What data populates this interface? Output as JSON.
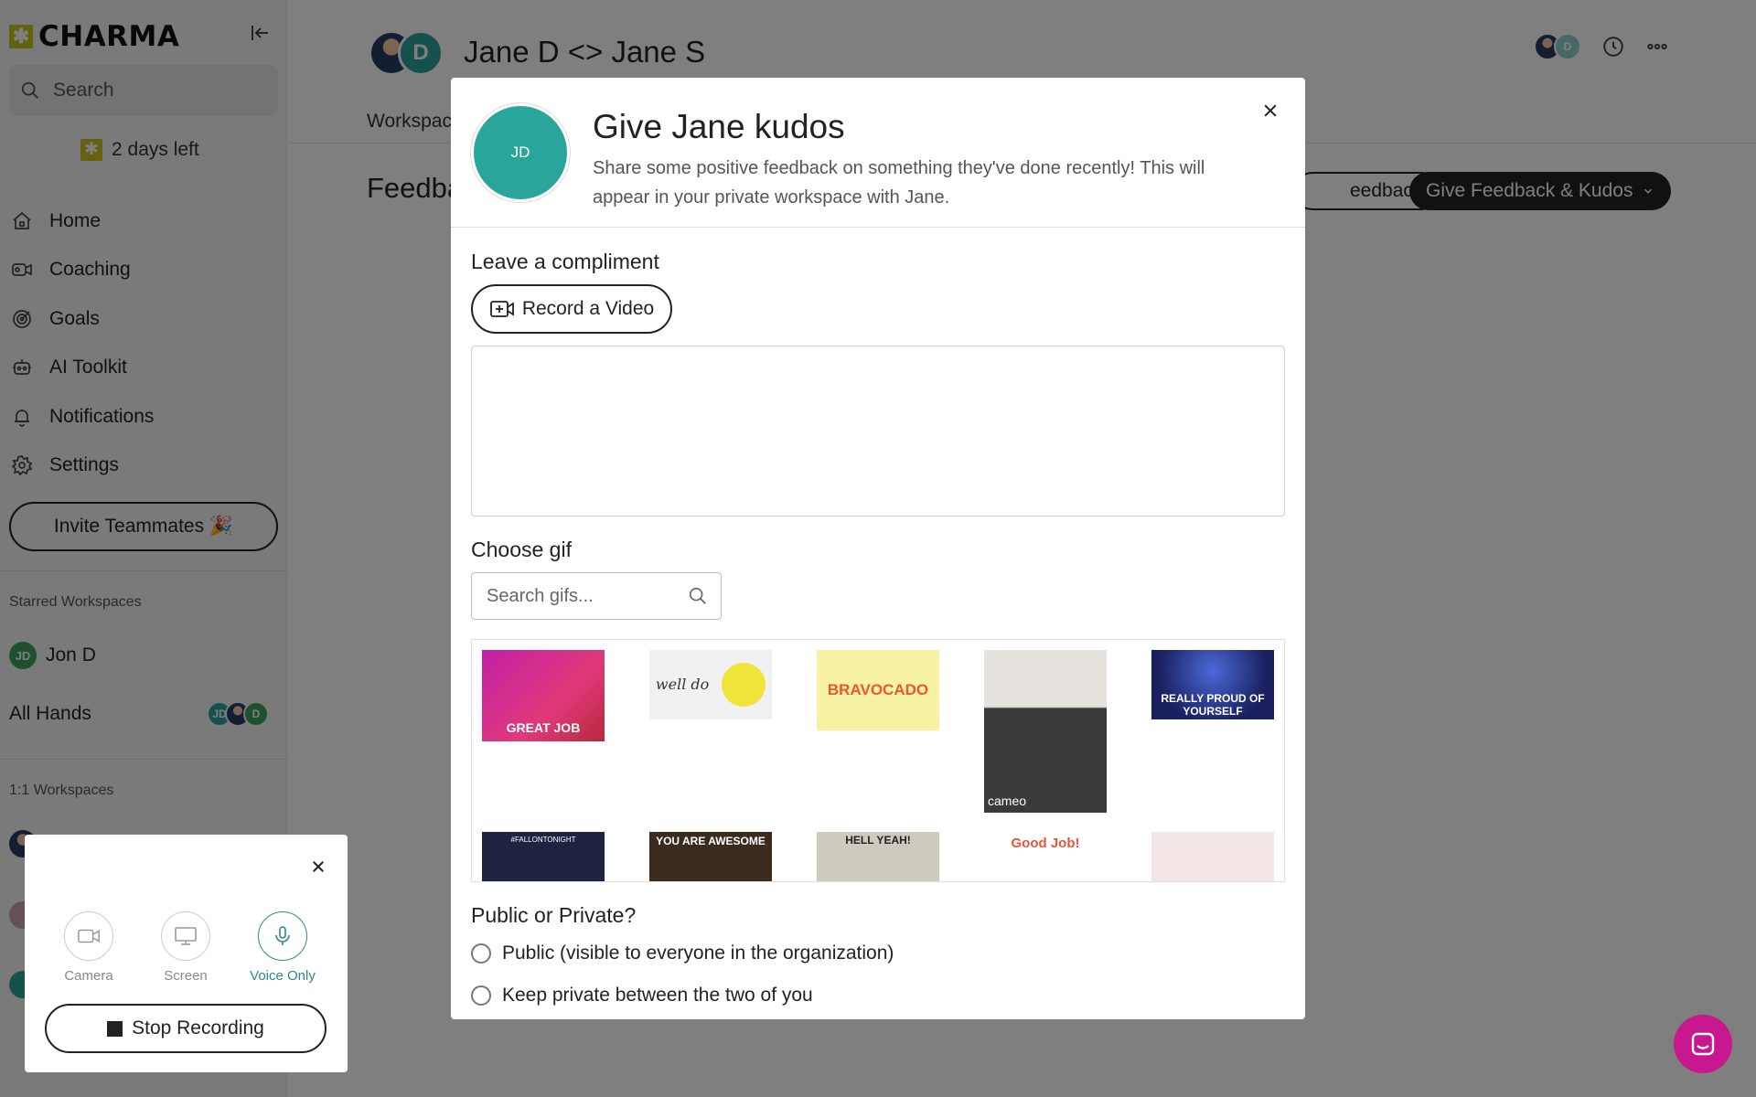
{
  "sidebar": {
    "logo": "CHARMA",
    "search_label": "Search",
    "trial": "2 days left",
    "nav": [
      {
        "label": "Home",
        "icon": "home-icon"
      },
      {
        "label": "Coaching",
        "icon": "coaching-icon"
      },
      {
        "label": "Goals",
        "icon": "goals-icon"
      },
      {
        "label": "AI Toolkit",
        "icon": "robot-icon"
      },
      {
        "label": "Notifications",
        "icon": "bell-icon"
      },
      {
        "label": "Settings",
        "icon": "gear-icon"
      }
    ],
    "invite_label": "Invite Teammates 🎉",
    "starred_label": "Starred Workspaces",
    "starred": [
      {
        "name": "Jon D",
        "initials": "JD"
      },
      {
        "name": "All Hands",
        "initials": [
          "JD",
          "D"
        ]
      }
    ],
    "one_on_one_label": "1:1 Workspaces"
  },
  "header": {
    "initial": "D",
    "title": "Jane D <> Jane S",
    "workspace_tab": "Workspac",
    "feedback_heading": "Feedba",
    "feedback_button": "eedback",
    "give_button": "Give Feedback & Kudos",
    "right_initial": "D"
  },
  "modal": {
    "avatar_initials": "JD",
    "title": "Give Jane kudos",
    "subtitle": "Share some positive feedback on something they've done recently! This will appear in your private workspace with Jane.",
    "compliment_label": "Leave a compliment",
    "record_label": "Record a Video",
    "gif_label": "Choose gif",
    "gif_search_placeholder": "Search gifs...",
    "gifs": [
      {
        "caption": "GREAT JOB"
      },
      {
        "caption": "well do"
      },
      {
        "caption": "BRAVOCADO"
      },
      {
        "caption": "cameo"
      },
      {
        "caption": "REALLY PROUD OF YOURSELF"
      },
      {
        "caption": "#FALLONTONIGHT"
      },
      {
        "caption": "YOU ARE AWESOME"
      },
      {
        "caption": "HELL YEAH!"
      },
      {
        "caption": "Good Job!"
      },
      {
        "caption": ""
      }
    ],
    "visibility_label": "Public or Private?",
    "public_option": "Public (visible to everyone in the organization)",
    "private_option": "Keep private between the two of you"
  },
  "recorder": {
    "camera_label": "Camera",
    "screen_label": "Screen",
    "voice_label": "Voice Only",
    "stop_label": "Stop Recording"
  },
  "colors": {
    "accent_teal": "#2aa59b",
    "chat_magenta": "#c8188f",
    "brand_yellow": "#c9c31e"
  }
}
